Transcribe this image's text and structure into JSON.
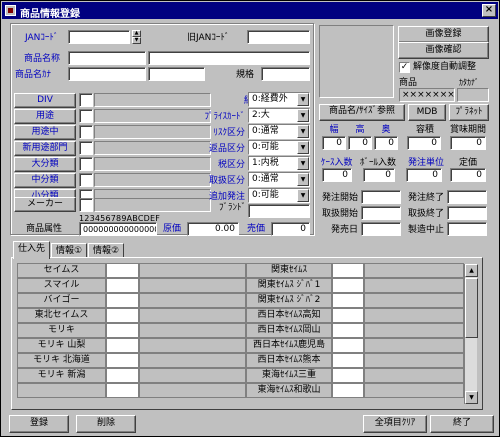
{
  "window": {
    "title": "商品情報登録",
    "close_glyph": "×"
  },
  "jan": {
    "label": "JANｺｰﾄﾞ",
    "old_label": "旧JANｺｰﾄﾞ",
    "value": "",
    "old_value": ""
  },
  "product": {
    "name_label": "商品名称",
    "kana_label": "商品名ｶﾅ",
    "spec_label": "規格"
  },
  "left_buttons": [
    "DIV",
    "用途",
    "用途中",
    "新用途部門",
    "大分類",
    "中分類",
    "小分類"
  ],
  "maker_label": "メーカー",
  "attr": {
    "label": "商品属性",
    "header": "123456789ABCDEF",
    "value": "000000000000000"
  },
  "cost": {
    "label": "原価",
    "value": "0.00"
  },
  "price": {
    "label": "売価",
    "value": "0"
  },
  "selects": [
    {
      "label": "経費",
      "value": "0:経費外"
    },
    {
      "label": "ﾌﾟﾗｲｽｶｰﾄﾞ",
      "value": "2:大"
    },
    {
      "label": "ﾘｽｸ区分",
      "value": "0:通常"
    },
    {
      "label": "返品区分",
      "value": "0:可能"
    },
    {
      "label": "税区分",
      "value": "1:内税"
    },
    {
      "label": "取扱区分",
      "value": "0:通常"
    },
    {
      "label": "追加発注",
      "value": "0:可能"
    }
  ],
  "brand_label": "ﾌﾞﾗﾝﾄﾞ",
  "image": {
    "register_label": "画像登録",
    "confirm_label": "画像確認",
    "auto_adjust_label": "解像度自動調整",
    "auto_adjust_checked": true
  },
  "name_col": {
    "label": "商品",
    "value": "×××××××"
  },
  "kana_col": {
    "label": "ｶﾀｶﾅﾞ",
    "value": ""
  },
  "ref_buttons": {
    "size_ref": "商品名/ｻｲｽﾞ参照",
    "mdb": "MDB",
    "planet": "ﾌﾟﾗﾈｯﾄ"
  },
  "dims": {
    "width_label": "幅",
    "height_label": "高",
    "depth_label": "奥",
    "capacity_label": "容積",
    "shelf_label": "賞味期間",
    "width": "0",
    "height": "0",
    "depth": "0",
    "capacity": "0",
    "shelf": "0"
  },
  "packs": {
    "case_label": "ｹｰｽ入数",
    "ball_label": "ﾎﾞｰﾙ入数",
    "order_label": "発注単位",
    "fixed_label": "定価",
    "case": "0",
    "ball": "0",
    "order": "0",
    "fixed": "0"
  },
  "dates": {
    "order_start": "発注開始",
    "order_end": "発注終了",
    "handle_start": "取扱開始",
    "handle_end": "取扱終了",
    "release": "発売日",
    "discontinue": "製造中止"
  },
  "tabs": [
    "仕入先",
    "情報①",
    "情報②"
  ],
  "suppliers_left": [
    "セイムス",
    "スマイル",
    "バイゴー",
    "東北セイムス",
    "モリキ",
    "モリキ 山梨",
    "モリキ 北海道",
    "モリキ 新潟",
    ""
  ],
  "suppliers_right": [
    "関東ｾｲﾑｽ",
    "関東ｾｲﾑｽ ｼﾞﾊﾞ1",
    "関東ｾｲﾑｽ ｼﾞﾊﾞ2",
    "西日本ｾｲﾑｽ高知",
    "西日本ｾｲﾑｽ岡山",
    "西日本ｾｲﾑｽ鹿児島",
    "西日本ｾｲﾑｽ熊本",
    "東海ｾｲﾑｽ三重",
    "東海ｾｲﾑｽ和歌山"
  ],
  "footer": {
    "register": "登録",
    "delete": "削除",
    "clear_all": "全項目ｸﾘｱ",
    "exit": "終了"
  }
}
